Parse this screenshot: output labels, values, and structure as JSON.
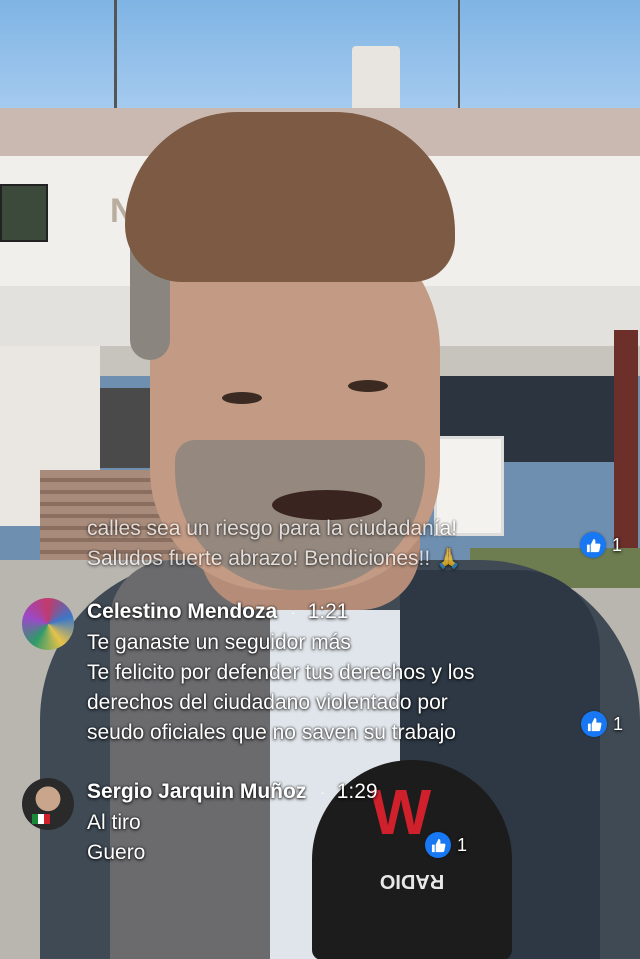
{
  "comments": [
    {
      "partial": true,
      "lines": [
        "calles sea un riesgo para la ciudadanía!",
        "Saludos fuerte abrazo! Bendiciones!!"
      ],
      "emoji": "🙏",
      "likes": "1"
    },
    {
      "author": "Celestino Mendoza",
      "time": "1:21",
      "lines": [
        "Te ganaste un seguidor más",
        "Te felicito por defender tus derechos y los",
        "derechos del ciudadano  violentado por",
        "seudo oficiales que no saven su trabajo"
      ],
      "likes": "1",
      "avatar_icon": "mosaic-avatar"
    },
    {
      "author": "Sergio Jarquin Muñoz",
      "time": "1:29",
      "lines": [
        "Al tiro",
        "Guero"
      ],
      "likes": "1",
      "avatar_icon": "profile-photo-avatar"
    }
  ],
  "background": {
    "facade_text": "NTO DE CO",
    "microphone_logo": "W",
    "microphone_label": "RADIO"
  },
  "colors": {
    "like_badge": "#1877f2",
    "text": "#ffffff"
  }
}
